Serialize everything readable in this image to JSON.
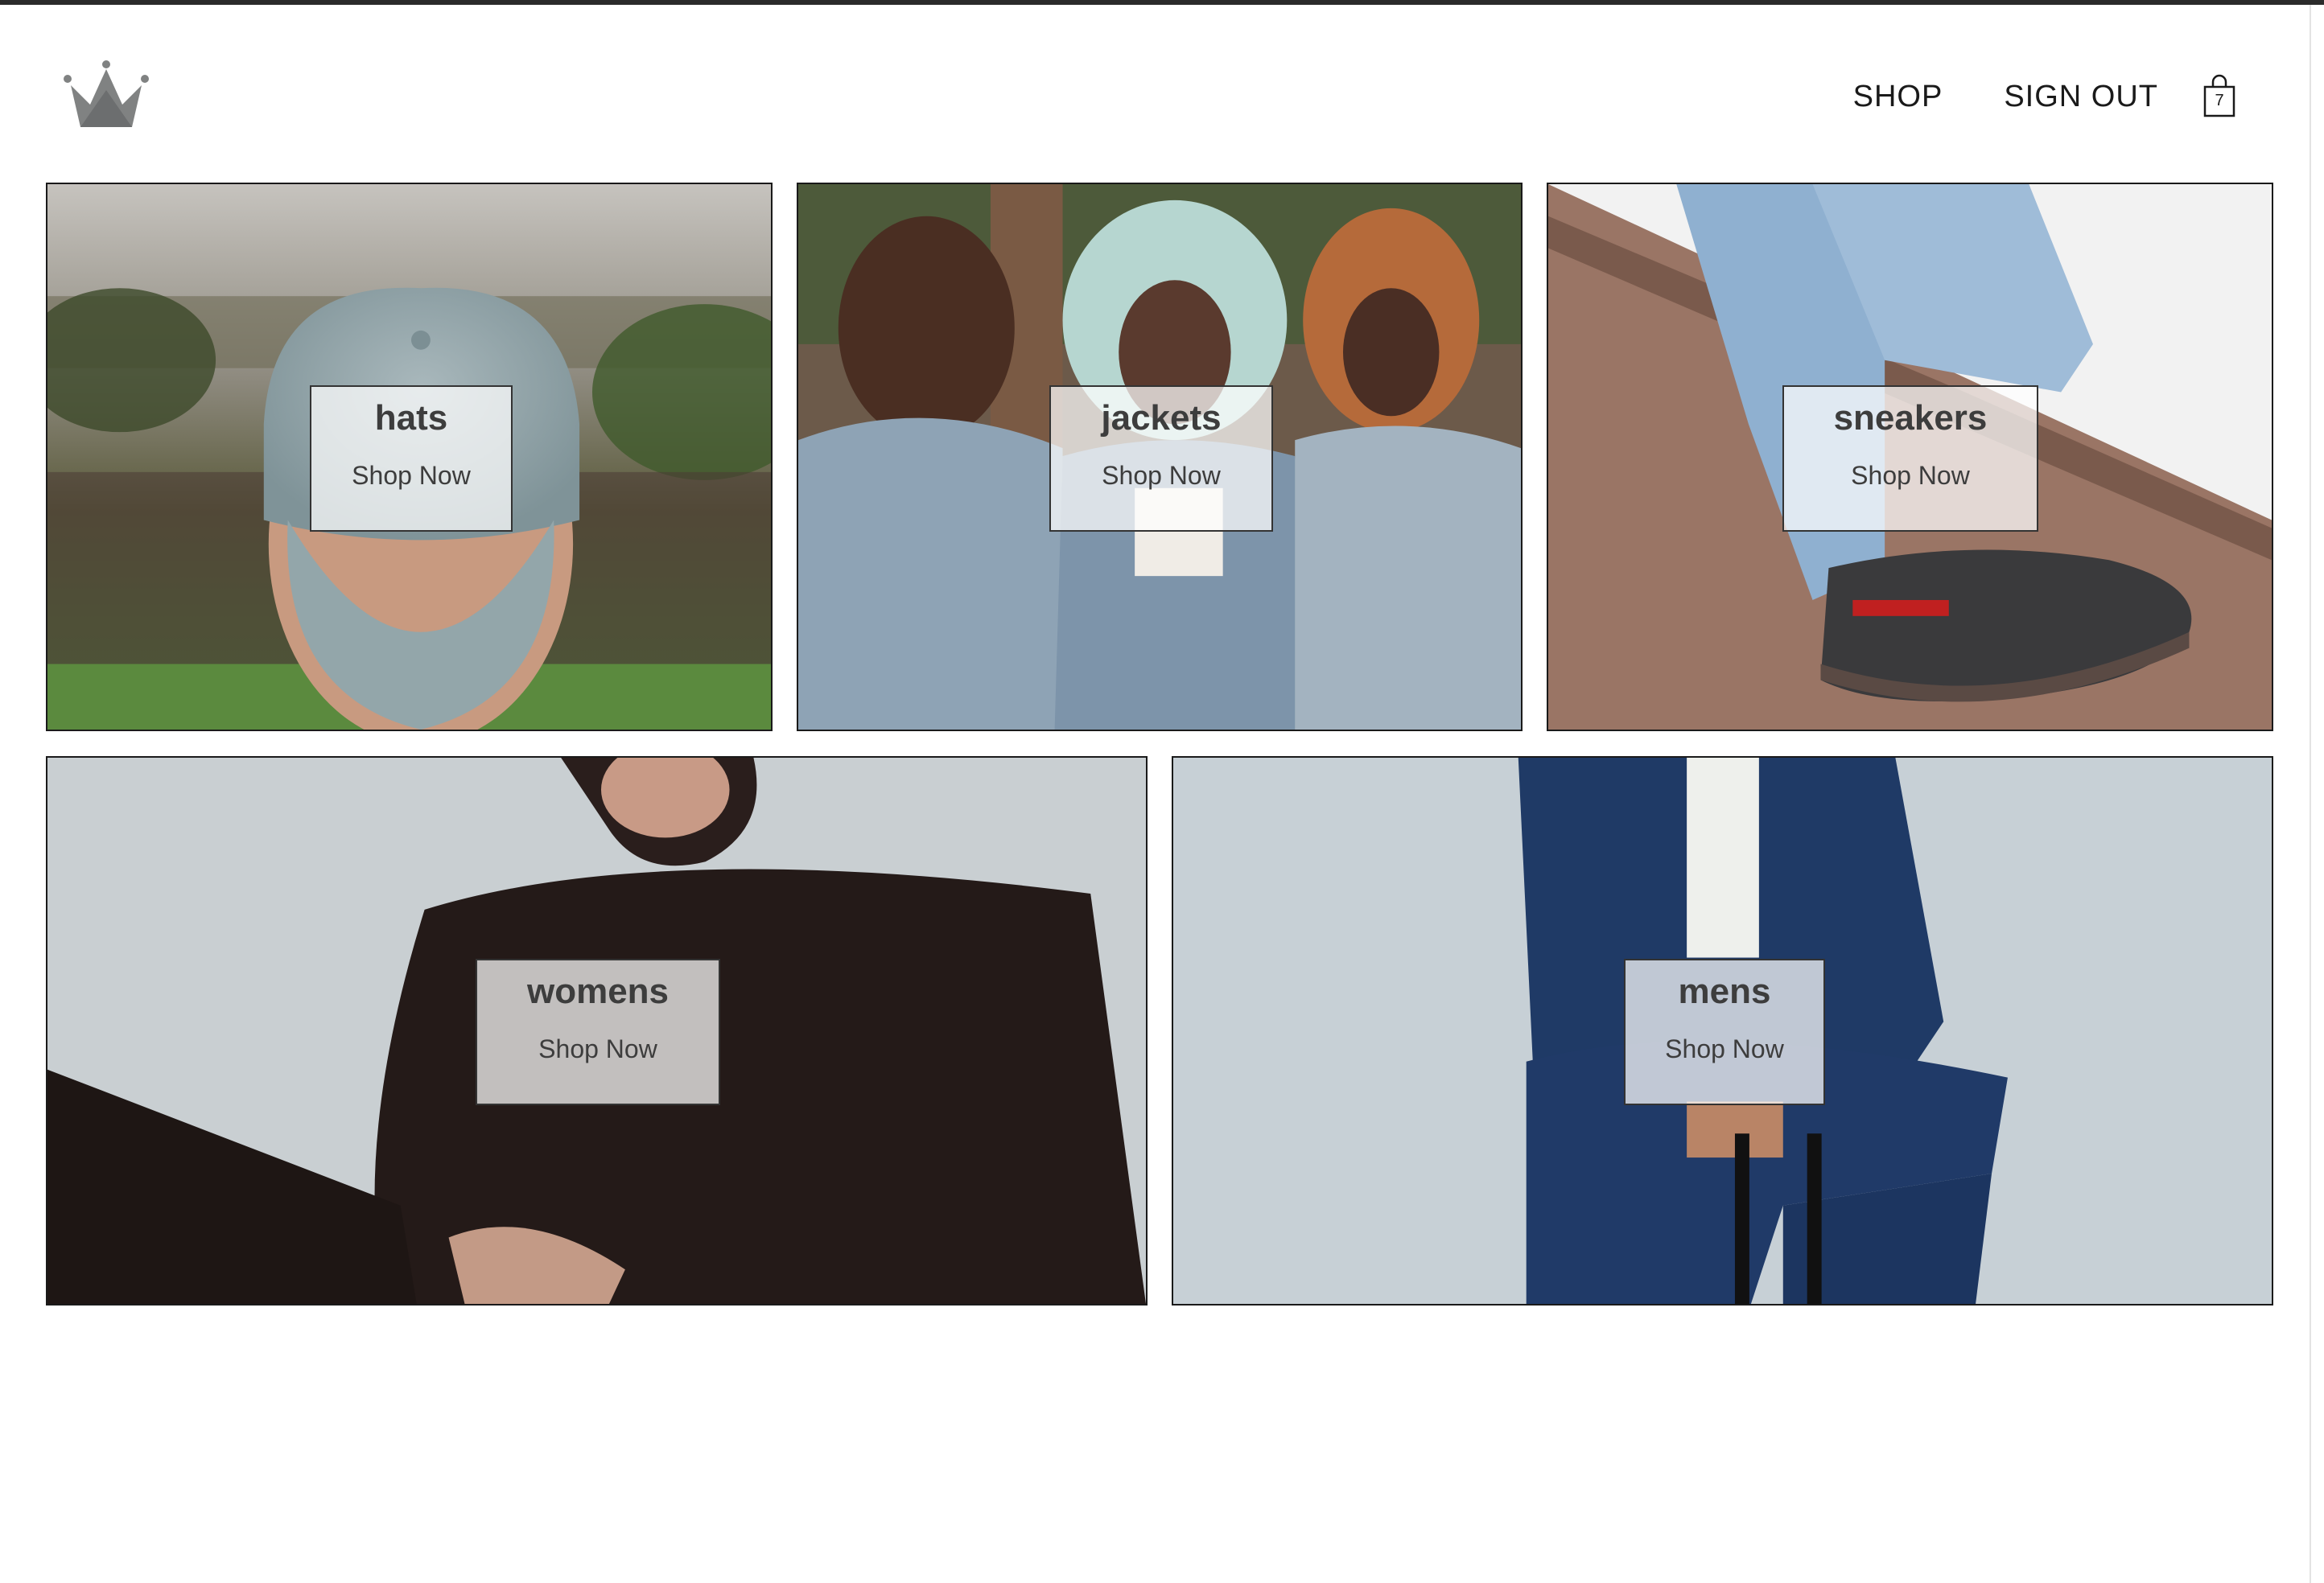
{
  "header": {
    "nav": {
      "shop_label": "SHOP",
      "sign_out_label": "SIGN OUT"
    },
    "cart": {
      "count": "7",
      "icon": "shopping-bag-icon"
    },
    "logo": {
      "icon": "crown-icon",
      "color": "#808282"
    }
  },
  "directory": {
    "items": [
      {
        "title": "hats",
        "subtitle": "Shop Now"
      },
      {
        "title": "jackets",
        "subtitle": "Shop Now"
      },
      {
        "title": "sneakers",
        "subtitle": "Shop Now"
      },
      {
        "title": "womens",
        "subtitle": "Shop Now"
      },
      {
        "title": "mens",
        "subtitle": "Shop Now"
      }
    ]
  },
  "colors": {
    "text": "#1a1a1a",
    "border": "#1a1a1a",
    "overlay": "#ffffff"
  }
}
